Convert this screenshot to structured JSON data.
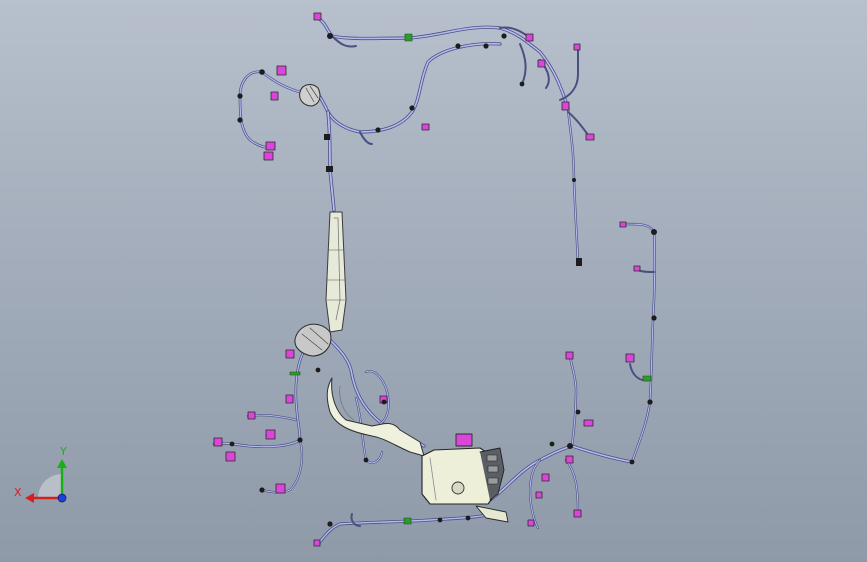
{
  "viewport": {
    "background_top": "#b7c0cc",
    "background_bottom": "#8f9aa9"
  },
  "model": {
    "wire_color": "#9ea3e6",
    "wire_dark_color": "#3a3e66",
    "connector_color": "#d946d9",
    "clip_color": "#1f1f1f",
    "marker_color": "#2e8b2e",
    "housing_color": "#e9ecd6"
  },
  "triad": {
    "x_label": "X",
    "y_label": "Y",
    "x_color": "#d62020",
    "y_color": "#18b018",
    "z_color": "#1f3fd6",
    "icon": "coordinate-triad-icon"
  }
}
